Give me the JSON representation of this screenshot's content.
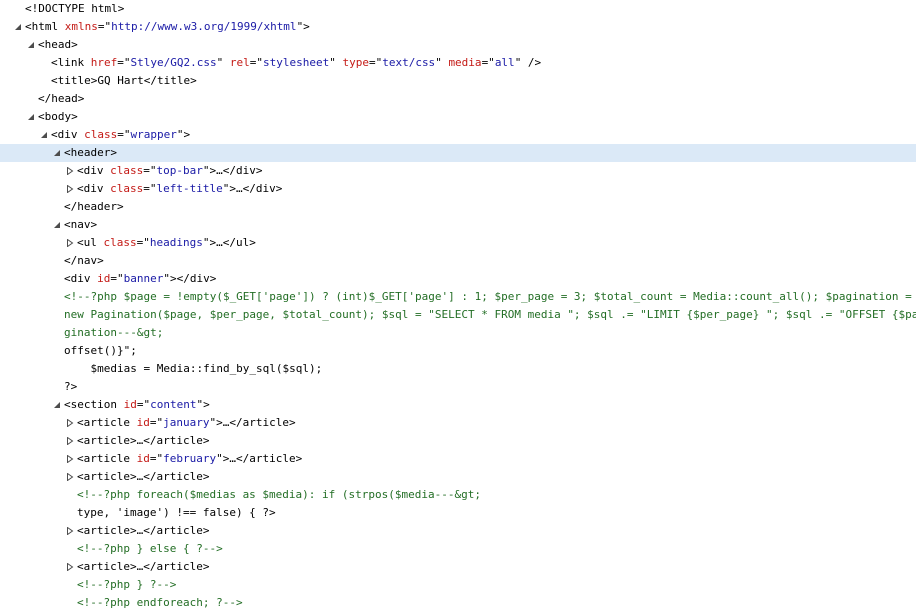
{
  "rows": [
    {
      "depth": 0,
      "toggle": "none",
      "parts": [
        [
          "tag",
          "<!DOCTYPE html>"
        ]
      ]
    },
    {
      "depth": 0,
      "toggle": "expanded",
      "parts": [
        [
          "tag",
          "<html "
        ],
        [
          "attr-name",
          "xmlns"
        ],
        [
          "tag",
          "=\""
        ],
        [
          "attr-value",
          "http://www.w3.org/1999/xhtml"
        ],
        [
          "tag",
          "\">"
        ]
      ]
    },
    {
      "depth": 1,
      "toggle": "expanded",
      "parts": [
        [
          "tag",
          "<head>"
        ]
      ]
    },
    {
      "depth": 2,
      "toggle": "none",
      "parts": [
        [
          "tag",
          "<link "
        ],
        [
          "attr-name",
          "href"
        ],
        [
          "tag",
          "=\""
        ],
        [
          "attr-value",
          "Stlye/GQ2.css"
        ],
        [
          "tag",
          "\" "
        ],
        [
          "attr-name",
          "rel"
        ],
        [
          "tag",
          "=\""
        ],
        [
          "attr-value",
          "stylesheet"
        ],
        [
          "tag",
          "\" "
        ],
        [
          "attr-name",
          "type"
        ],
        [
          "tag",
          "=\""
        ],
        [
          "attr-value",
          "text/css"
        ],
        [
          "tag",
          "\" "
        ],
        [
          "attr-name",
          "media"
        ],
        [
          "tag",
          "=\""
        ],
        [
          "attr-value",
          "all"
        ],
        [
          "tag",
          "\" />"
        ]
      ]
    },
    {
      "depth": 2,
      "toggle": "none",
      "parts": [
        [
          "tag",
          "<title>"
        ],
        [
          "text",
          "GQ Hart"
        ],
        [
          "tag",
          "</title>"
        ]
      ]
    },
    {
      "depth": 1,
      "toggle": "none",
      "parts": [
        [
          "tag",
          "</head>"
        ]
      ]
    },
    {
      "depth": 1,
      "toggle": "expanded",
      "parts": [
        [
          "tag",
          "<body>"
        ]
      ]
    },
    {
      "depth": 2,
      "toggle": "expanded",
      "parts": [
        [
          "tag",
          "<div "
        ],
        [
          "attr-name",
          "class"
        ],
        [
          "tag",
          "=\""
        ],
        [
          "attr-value",
          "wrapper"
        ],
        [
          "tag",
          "\">"
        ]
      ]
    },
    {
      "depth": 3,
      "toggle": "expanded",
      "selected": true,
      "parts": [
        [
          "tag",
          "<header>"
        ]
      ]
    },
    {
      "depth": 4,
      "toggle": "collapsed",
      "parts": [
        [
          "tag",
          "<div "
        ],
        [
          "attr-name",
          "class"
        ],
        [
          "tag",
          "=\""
        ],
        [
          "attr-value",
          "top-bar"
        ],
        [
          "tag",
          "\">…</div>"
        ]
      ]
    },
    {
      "depth": 4,
      "toggle": "collapsed",
      "parts": [
        [
          "tag",
          "<div "
        ],
        [
          "attr-name",
          "class"
        ],
        [
          "tag",
          "=\""
        ],
        [
          "attr-value",
          "left-title"
        ],
        [
          "tag",
          "\">…</div>"
        ]
      ]
    },
    {
      "depth": 3,
      "toggle": "none",
      "parts": [
        [
          "tag",
          "</header>"
        ]
      ]
    },
    {
      "depth": 3,
      "toggle": "expanded",
      "parts": [
        [
          "tag",
          "<nav>"
        ]
      ]
    },
    {
      "depth": 4,
      "toggle": "collapsed",
      "parts": [
        [
          "tag",
          "<ul "
        ],
        [
          "attr-name",
          "class"
        ],
        [
          "tag",
          "=\""
        ],
        [
          "attr-value",
          "headings"
        ],
        [
          "tag",
          "\">…</ul>"
        ]
      ]
    },
    {
      "depth": 3,
      "toggle": "none",
      "parts": [
        [
          "tag",
          "</nav>"
        ]
      ]
    },
    {
      "depth": 3,
      "toggle": "none",
      "parts": [
        [
          "tag",
          "<div "
        ],
        [
          "attr-name",
          "id"
        ],
        [
          "tag",
          "=\""
        ],
        [
          "attr-value",
          "banner"
        ],
        [
          "tag",
          "\"></div>"
        ]
      ]
    },
    {
      "depth": 3,
      "toggle": "none",
      "parts": [
        [
          "comment",
          "<!--?php $page = !empty($_GET['page']) ? (int)$_GET['page'] : 1; $per_page = 3; $total_count = Media::count_all(); $pagination ="
        ]
      ]
    },
    {
      "depth": 3,
      "toggle": "none",
      "parts": [
        [
          "comment",
          "new Pagination($page, $per_page, $total_count); $sql = \"SELECT * FROM media \"; $sql .= \"LIMIT {$per_page} \"; $sql .= \"OFFSET {$pa"
        ]
      ]
    },
    {
      "depth": 3,
      "toggle": "none",
      "parts": [
        [
          "comment",
          "gination---&gt;"
        ]
      ]
    },
    {
      "depth": 3,
      "toggle": "none",
      "parts": [
        [
          "text",
          "offset()}\";"
        ]
      ]
    },
    {
      "depth": 3,
      "toggle": "none",
      "parts": [
        [
          "text",
          "    $medias = Media::find_by_sql($sql);"
        ]
      ]
    },
    {
      "depth": 3,
      "toggle": "none",
      "parts": [
        [
          "text",
          "?>"
        ]
      ]
    },
    {
      "depth": 3,
      "toggle": "expanded",
      "parts": [
        [
          "tag",
          "<section "
        ],
        [
          "attr-name",
          "id"
        ],
        [
          "tag",
          "=\""
        ],
        [
          "attr-value",
          "content"
        ],
        [
          "tag",
          "\">"
        ]
      ]
    },
    {
      "depth": 4,
      "toggle": "collapsed",
      "parts": [
        [
          "tag",
          "<article "
        ],
        [
          "attr-name",
          "id"
        ],
        [
          "tag",
          "=\""
        ],
        [
          "attr-value",
          "january"
        ],
        [
          "tag",
          "\">…</article>"
        ]
      ]
    },
    {
      "depth": 4,
      "toggle": "collapsed",
      "parts": [
        [
          "tag",
          "<article>…</article>"
        ]
      ]
    },
    {
      "depth": 4,
      "toggle": "collapsed",
      "parts": [
        [
          "tag",
          "<article "
        ],
        [
          "attr-name",
          "id"
        ],
        [
          "tag",
          "=\""
        ],
        [
          "attr-value",
          "february"
        ],
        [
          "tag",
          "\">…</article>"
        ]
      ]
    },
    {
      "depth": 4,
      "toggle": "collapsed",
      "parts": [
        [
          "tag",
          "<article>…</article>"
        ]
      ]
    },
    {
      "depth": 4,
      "toggle": "none",
      "parts": [
        [
          "comment",
          "<!--?php foreach($medias as $media): if (strpos($media---&gt;"
        ]
      ]
    },
    {
      "depth": 4,
      "toggle": "none",
      "parts": [
        [
          "text",
          "type, 'image') !== false) { ?>"
        ]
      ]
    },
    {
      "depth": 4,
      "toggle": "collapsed",
      "parts": [
        [
          "tag",
          "<article>…</article>"
        ]
      ]
    },
    {
      "depth": 4,
      "toggle": "none",
      "parts": [
        [
          "comment",
          "<!--?php } else { ?-->"
        ]
      ]
    },
    {
      "depth": 4,
      "toggle": "collapsed",
      "parts": [
        [
          "tag",
          "<article>…</article>"
        ]
      ]
    },
    {
      "depth": 4,
      "toggle": "none",
      "parts": [
        [
          "comment",
          "<!--?php } ?-->"
        ]
      ]
    },
    {
      "depth": 4,
      "toggle": "none",
      "parts": [
        [
          "comment",
          "<!--?php endforeach; ?-->"
        ]
      ]
    }
  ],
  "colors": {
    "tag": "#000000",
    "attr_name": "#c41a16",
    "attr_value": "#1a1aa6",
    "comment": "#236e25",
    "selected_row": "#dbe9f7",
    "toggle": "#4d4d4d"
  }
}
